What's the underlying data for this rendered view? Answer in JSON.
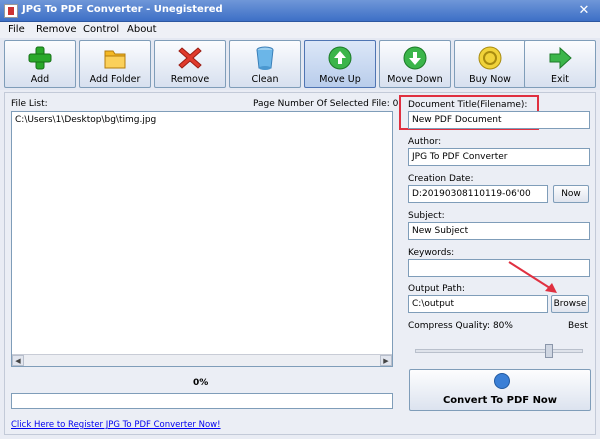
{
  "window": {
    "title": "JPG To PDF Converter - Unegistered",
    "close_glyph": "✕"
  },
  "menu": [
    "File",
    "Remove",
    "Control",
    "About"
  ],
  "toolbar": [
    {
      "label": "Add",
      "icon": "plus-icon"
    },
    {
      "label": "Add Folder",
      "icon": "folder-icon"
    },
    {
      "label": "Remove",
      "icon": "remove-x-icon"
    },
    {
      "label": "Clean",
      "icon": "bin-icon"
    },
    {
      "label": "Move Up",
      "icon": "arrow-up-icon"
    },
    {
      "label": "Move Down",
      "icon": "arrow-down-icon"
    },
    {
      "label": "Buy Now",
      "icon": "coin-icon"
    },
    {
      "label": "Exit",
      "icon": "arrow-right-icon"
    }
  ],
  "file_list": {
    "label": "File List:",
    "page_number_label": "Page Number Of Selected File: 0",
    "items": [
      "C:\\Users\\1\\Desktop\\bg\\timg.jpg"
    ]
  },
  "progress": {
    "text": "0%",
    "value": 0
  },
  "register_link": "Click Here to Register JPG To PDF Converter Now!",
  "form": {
    "doc_title_label": "Document Title(Filename):",
    "doc_title_value": "New PDF Document",
    "author_label": "Author:",
    "author_value": "JPG To PDF Converter",
    "creation_label": "Creation Date:",
    "creation_value": "D:20190308110119-06'00",
    "now_button": "Now",
    "subject_label": "Subject:",
    "subject_value": "New Subject",
    "keywords_label": "Keywords:",
    "keywords_value": "",
    "output_label": "Output Path:",
    "output_value": "C:\\output",
    "browse_button": "Browse",
    "compress_label": "Compress Quality: 80%",
    "compress_value": 80,
    "best_label": "Best"
  },
  "convert_button": "Convert To PDF Now",
  "colors": {
    "highlight": "#e03040",
    "titlebar": "#3d6fc6",
    "link": "#0000ee"
  }
}
